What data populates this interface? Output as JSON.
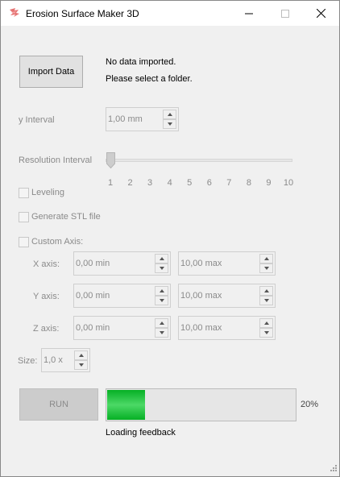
{
  "window": {
    "title": "Erosion Surface Maker 3D",
    "icon": "app-logo-icon",
    "controls": [
      "minimize-icon",
      "maximize-icon",
      "close-icon"
    ]
  },
  "import": {
    "button_label": "Import Data",
    "status_line1": "No data imported.",
    "status_line2": "Please select a folder."
  },
  "y_interval": {
    "label": "y Interval",
    "value": "1,00 mm"
  },
  "resolution": {
    "label": "Resolution Interval",
    "ticks": [
      "1",
      "2",
      "3",
      "4",
      "5",
      "6",
      "7",
      "8",
      "9",
      "10"
    ],
    "value": 1
  },
  "options": {
    "leveling": {
      "label": "Leveling",
      "checked": false
    },
    "generate_stl": {
      "label": "Generate STL file",
      "checked": false
    },
    "custom_axis": {
      "label": "Custom Axis:",
      "checked": false
    }
  },
  "axes": {
    "x": {
      "label": "X axis:",
      "min": "0,00 min",
      "max": "10,00 max"
    },
    "y": {
      "label": "Y axis:",
      "min": "0,00 min",
      "max": "10,00 max"
    },
    "z": {
      "label": "Z axis:",
      "min": "0,00 min",
      "max": "10,00 max"
    }
  },
  "size": {
    "label": "Size:",
    "value": "1,0 x"
  },
  "run": {
    "button_label": "RUN",
    "progress_percent": 20,
    "progress_text": "20%",
    "feedback": "Loading feedback"
  },
  "colors": {
    "progress_green": "#06b025",
    "disabled_text": "#8a8a8a"
  }
}
